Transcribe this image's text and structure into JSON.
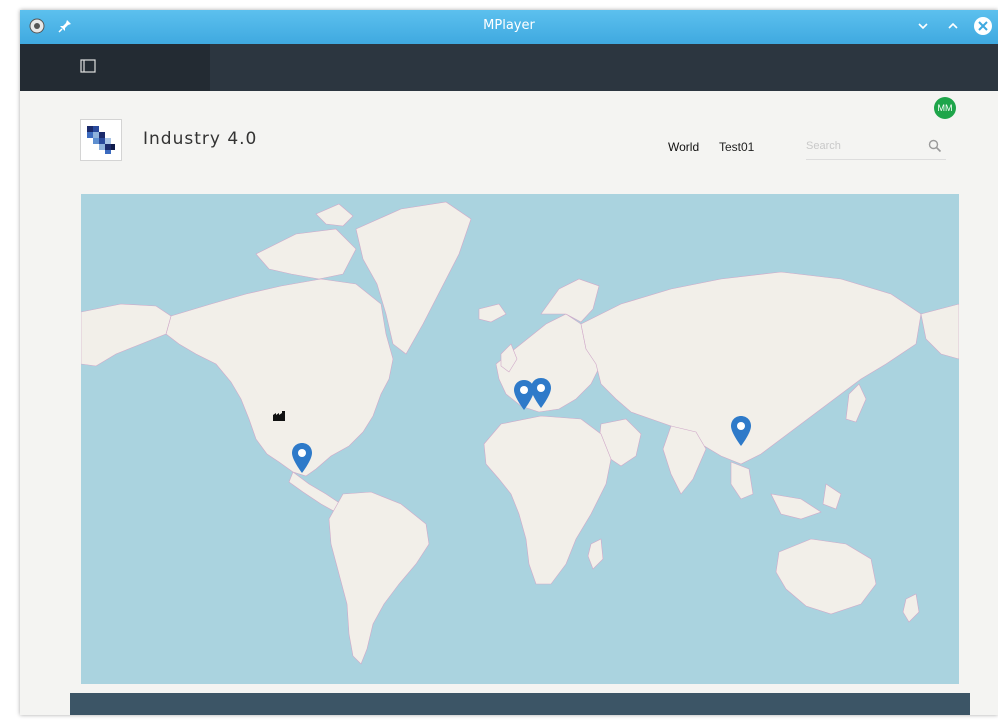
{
  "window": {
    "title": "MPlayer",
    "controls": [
      "app-icon",
      "pin-icon",
      "minimize-icon",
      "maximize-icon",
      "close-icon"
    ]
  },
  "app": {
    "brand": "Industry 4.0",
    "avatar_initials": "MM",
    "nav": {
      "world": "World",
      "test": "Test01"
    },
    "search": {
      "placeholder": "Search",
      "value": ""
    }
  },
  "map": {
    "markers": [
      "marker-mexico",
      "marker-europe-west",
      "marker-europe-east",
      "marker-china",
      "marker-usa-factory"
    ]
  },
  "colors": {
    "titlebar": "#3fa9e0",
    "appbar": "#2c3640",
    "ocean": "#aad3df",
    "land": "#f2efe9",
    "marker": "#2e7ac9",
    "avatar": "#1ea54a",
    "footer": "#3c5566"
  }
}
